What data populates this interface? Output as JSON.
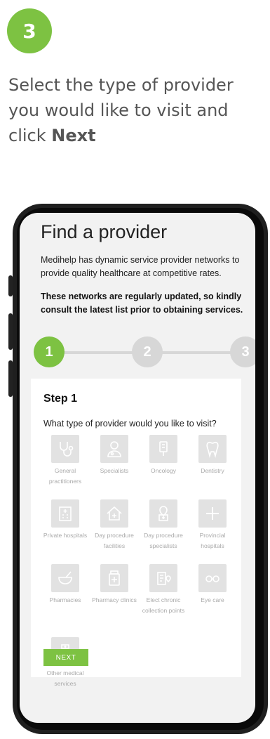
{
  "header": {
    "step_number": "3",
    "instruction_prefix": "Select the type of provider you would like to visit and click ",
    "instruction_bold": "Next"
  },
  "app": {
    "title": "Find a provider",
    "intro": "Medihelp has dynamic service provider networks to provide quality healthcare at competitive rates.",
    "notice": "These networks are regularly updated, so kindly consult the latest list prior to obtaining services.",
    "stepper": {
      "steps": [
        "1",
        "2",
        "3"
      ],
      "active_step": "1",
      "active_color": "#7dc242",
      "inactive_color": "#d7d7d7"
    },
    "card": {
      "heading": "Step 1",
      "question": "What type of provider would you like to visit?",
      "providers": [
        {
          "label": "General practitioners",
          "icon": "stethoscope-icon"
        },
        {
          "label": "Specialists",
          "icon": "doctor-icon"
        },
        {
          "label": "Oncology",
          "icon": "iv-drip-icon"
        },
        {
          "label": "Dentistry",
          "icon": "tooth-icon"
        },
        {
          "label": "Private hospitals",
          "icon": "hospital-building-icon"
        },
        {
          "label": "Day procedure facilities",
          "icon": "house-plus-icon"
        },
        {
          "label": "Day procedure specialists",
          "icon": "location-plus-icon"
        },
        {
          "label": "Provincial hospitals",
          "icon": "plus-icon"
        },
        {
          "label": "Pharmacies",
          "icon": "mortar-pestle-icon"
        },
        {
          "label": "Pharmacy clinics",
          "icon": "medicine-bottle-icon"
        },
        {
          "label": "Elect chronic collection points",
          "icon": "pharmacy-location-icon"
        },
        {
          "label": "Eye care",
          "icon": "glasses-icon"
        },
        {
          "label": "Other medical services",
          "icon": "nurse-icon"
        }
      ],
      "next_label": "NEXT"
    }
  },
  "colors": {
    "accent": "#7dc242",
    "tile_bg": "#e2e2e2",
    "tile_label": "#aaaaaa"
  }
}
